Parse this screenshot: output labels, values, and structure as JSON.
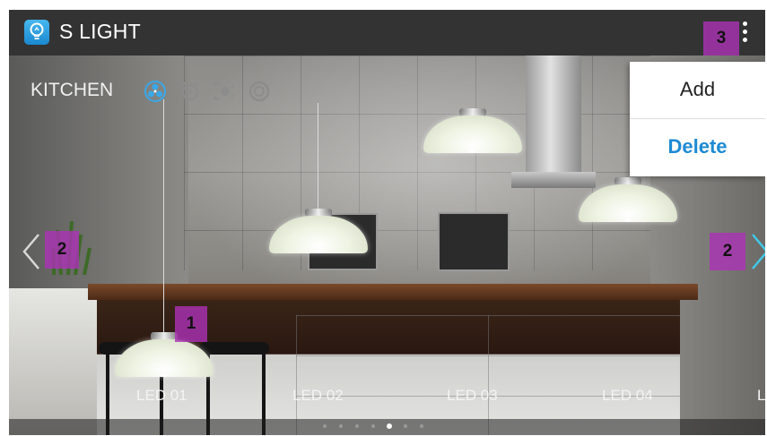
{
  "app": {
    "title": "S LIGHT",
    "icon": "lightbulb-icon"
  },
  "actionbar": {
    "overflow_icon": "more-vert-icon"
  },
  "room": {
    "name": "KITCHEN",
    "mode_icons": [
      "fan-icon",
      "alarm-clock-icon",
      "dimmer-icon",
      "power-icon"
    ],
    "active_mode_color": "#3aa8e8"
  },
  "menu": {
    "items": [
      {
        "label": "Add"
      },
      {
        "label": "Delete"
      }
    ]
  },
  "lights": [
    {
      "label": "LED 01"
    },
    {
      "label": "LED 02"
    },
    {
      "label": "LED 03"
    },
    {
      "label": "LED 04"
    },
    {
      "label": "L"
    }
  ],
  "navigation": {
    "prev_icon": "chevron-left-icon",
    "next_icon": "chevron-right-icon",
    "next_color": "#41c8e6"
  },
  "pager": {
    "pages": 7,
    "current": 5
  },
  "callouts": [
    {
      "text": "1"
    },
    {
      "text": "2"
    },
    {
      "text": "2"
    },
    {
      "text": "3"
    }
  ]
}
